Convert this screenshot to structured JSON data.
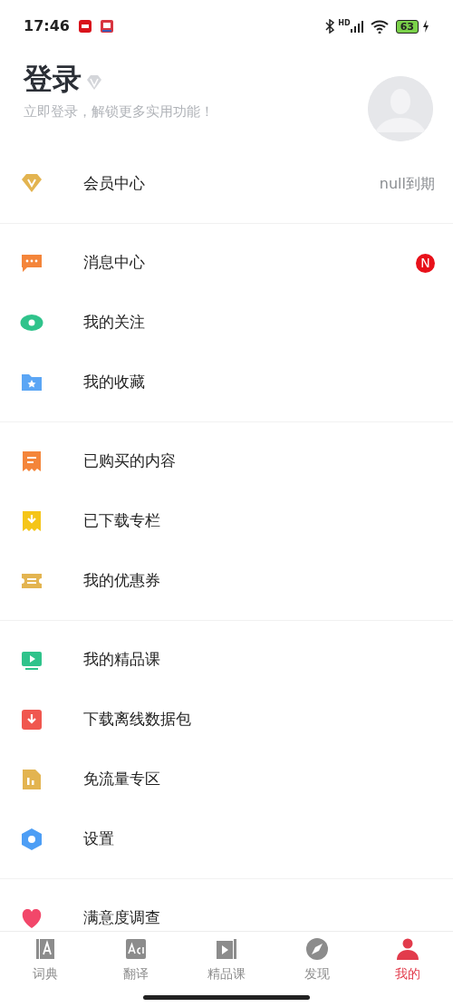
{
  "status_bar": {
    "time": "17:46",
    "network": "HD",
    "battery": "63"
  },
  "header": {
    "title": "登录",
    "subtitle": "立即登录，解锁更多实用功能！"
  },
  "sections": [
    [
      {
        "label": "会员中心",
        "trailing": "null到期"
      }
    ],
    [
      {
        "label": "消息中心",
        "badge": "N"
      },
      {
        "label": "我的关注"
      },
      {
        "label": "我的收藏"
      }
    ],
    [
      {
        "label": "已购买的内容"
      },
      {
        "label": "已下载专栏"
      },
      {
        "label": "我的优惠券"
      }
    ],
    [
      {
        "label": "我的精品课"
      },
      {
        "label": "下载离线数据包"
      },
      {
        "label": "免流量专区"
      },
      {
        "label": "设置"
      }
    ],
    [
      {
        "label": "满意度调查"
      }
    ]
  ],
  "tab_bar": [
    {
      "label": "词典",
      "selected": false
    },
    {
      "label": "翻译",
      "selected": false
    },
    {
      "label": "精品课",
      "selected": false
    },
    {
      "label": "发现",
      "selected": false
    },
    {
      "label": "我的",
      "selected": true
    }
  ]
}
